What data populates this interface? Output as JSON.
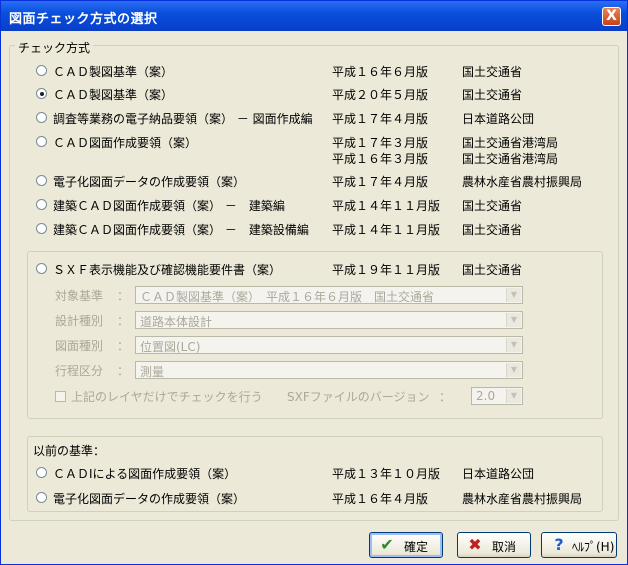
{
  "window": {
    "title": "図面チェック方式の選択",
    "close_label": "X"
  },
  "check_group": {
    "legend": "チェック方式",
    "options": [
      {
        "label": "ＣＡＤ製図基準（案）",
        "version": "平成１６年６月版",
        "org": "国土交通省",
        "version2": "",
        "org2": ""
      },
      {
        "label": "ＣＡＤ製図基準（案）",
        "version": "平成２０年５月版",
        "org": "国土交通省",
        "version2": "",
        "org2": ""
      },
      {
        "label": "調査等業務の電子納品要領（案） － 図面作成編",
        "version": "平成１７年４月版",
        "org": "日本道路公団",
        "version2": "",
        "org2": ""
      },
      {
        "label": "ＣＡＤ図面作成要領（案）",
        "version": "平成１７年３月版",
        "org": "国土交通省港湾局",
        "version2": "平成１６年３月版",
        "org2": "国土交通省港湾局"
      },
      {
        "label": "電子化図面データの作成要領（案）",
        "version": "平成１７年４月版",
        "org": "農林水産省農村振興局",
        "version2": "",
        "org2": ""
      },
      {
        "label": "建築ＣＡＤ図面作成要領（案） －　建築編",
        "version": "平成１４年１１月版",
        "org": "国土交通省",
        "version2": "",
        "org2": ""
      },
      {
        "label": "建築ＣＡＤ図面作成要領（案） －　建築設備編",
        "version": "平成１４年１１月版",
        "org": "国土交通省",
        "version2": "",
        "org2": ""
      }
    ],
    "selected_index": 1
  },
  "sxf_group": {
    "option": {
      "label": "ＳＸＦ表示機能及び確認機能要件書（案）",
      "version": "平成１９年１１月版",
      "org": "国土交通省"
    },
    "colon": "：",
    "fields": [
      {
        "label": "対象基準",
        "value": "ＣＡＤ製図基準（案）　平成１６年６月版　国土交通省"
      },
      {
        "label": "設計種別",
        "value": "道路本体設計"
      },
      {
        "label": "図面種別",
        "value": "位置図(LC)"
      },
      {
        "label": "行程区分",
        "value": "測量"
      }
    ],
    "layer_check_label": "上記のレイヤだけでチェックを行う",
    "version_label": "SXFファイルのバージョン",
    "version_colon": "：",
    "version_value": "2.0"
  },
  "previous_group": {
    "legend": "以前の基準：",
    "options": [
      {
        "label": "ＣＡＤIによる図面作成要領（案）",
        "version": "平成１３年１０月版",
        "org": "日本道路公団"
      },
      {
        "label": "電子化図面データの作成要領（案）",
        "version": "平成１６年４月版",
        "org": "農林水産省農村振興局"
      }
    ]
  },
  "buttons": {
    "ok_label": "確定",
    "cancel_label": "取消",
    "help_label": "ﾍﾙﾌﾟ(H)"
  },
  "colors": {
    "titlebar": "#0a4fdb",
    "dialog_bg": "#ece9d8",
    "disabled_text": "#aca899",
    "ok_icon": "#2f8a2f",
    "cancel_icon": "#c02020",
    "help_icon": "#1e5fcf"
  }
}
